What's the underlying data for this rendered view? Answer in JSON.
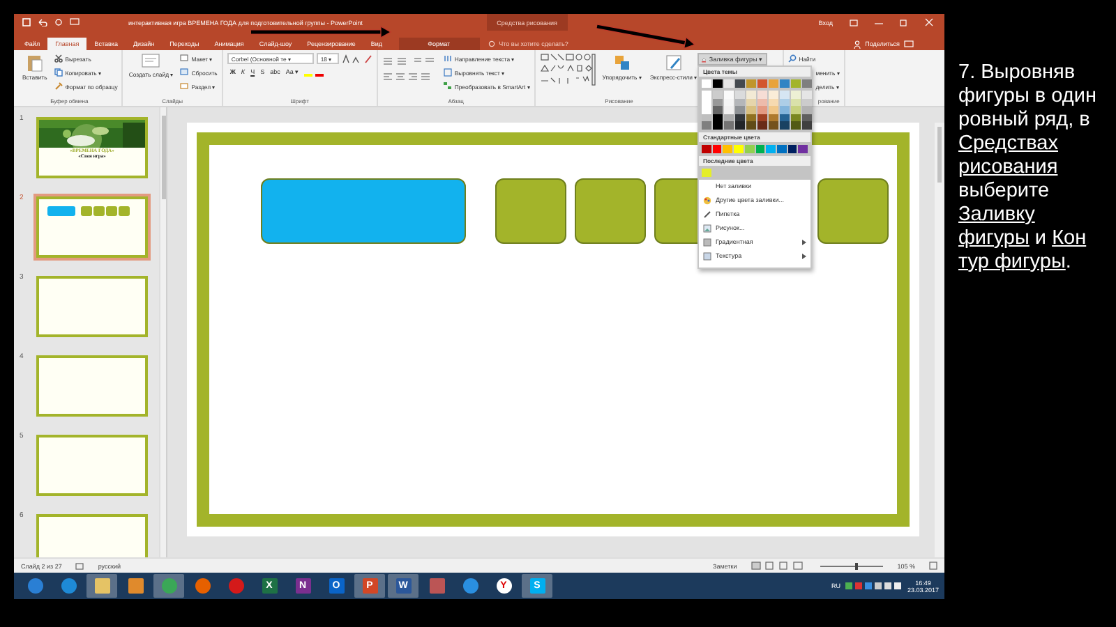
{
  "title_bar": {
    "title": "интерактивная игра ВРЕМЕНА ГОДА  для подготовительной группы  -  PowerPoint",
    "context_title": "Средства рисования",
    "sign_in": "Вход"
  },
  "tabs": [
    {
      "label": "Файл",
      "selected": false,
      "kind": "file"
    },
    {
      "label": "Главная",
      "selected": true,
      "kind": "main"
    },
    {
      "label": "Вставка",
      "selected": false,
      "kind": "main"
    },
    {
      "label": "Дизайн",
      "selected": false,
      "kind": "main"
    },
    {
      "label": "Переходы",
      "selected": false,
      "kind": "main"
    },
    {
      "label": "Анимация",
      "selected": false,
      "kind": "main"
    },
    {
      "label": "Слайд-шоу",
      "selected": false,
      "kind": "main"
    },
    {
      "label": "Рецензирование",
      "selected": false,
      "kind": "main"
    },
    {
      "label": "Вид",
      "selected": false,
      "kind": "main"
    },
    {
      "label": "Формат",
      "selected": false,
      "kind": "context"
    }
  ],
  "tell_me": {
    "placeholder": "Что вы хотите сделать?"
  },
  "share": "Поделиться",
  "ribbon": {
    "groups": [
      {
        "label": "Буфер обмена",
        "kind": "plain",
        "columns": [
          [
            {
              "kind": "large",
              "label": "Вставить"
            }
          ],
          [
            {
              "kind": "small",
              "label": "Вырезать"
            },
            {
              "kind": "small",
              "label": "Копировать  ▾"
            },
            {
              "kind": "small",
              "label": "Формат по образцу"
            }
          ]
        ]
      },
      {
        "label": "Слайды",
        "kind": "plain",
        "columns": [
          [
            {
              "kind": "large",
              "label": "Создать слайд ▾"
            }
          ],
          [
            {
              "kind": "small",
              "label": "Макет ▾"
            },
            {
              "kind": "small",
              "label": "Сбросить"
            },
            {
              "kind": "small",
              "label": "Раздел ▾"
            }
          ]
        ]
      },
      {
        "label": "Шрифт",
        "kind": "plain",
        "columns": [
          [
            {
              "kind": "font",
              "font": "Corbel (Основной те ▾",
              "size": "18 ▾"
            },
            {
              "kind": "glyphs",
              "glyphs": [
                "Ж",
                "К",
                "Ч",
                "S",
                "abc",
                "Aa ▾"
              ]
            }
          ]
        ]
      },
      {
        "label": "Абзац",
        "kind": "plain",
        "columns": [
          [
            {
              "kind": "para"
            }
          ],
          [
            {
              "kind": "small",
              "label": "Направление текста ▾"
            },
            {
              "kind": "small",
              "label": "Выровнять текст ▾"
            },
            {
              "kind": "small",
              "label": "Преобразовать в SmartArt ▾"
            }
          ]
        ]
      },
      {
        "label": "Рисование",
        "kind": "drawing",
        "columns": [
          [
            {
              "kind": "shapes"
            }
          ],
          [
            {
              "kind": "large",
              "label": "Упорядочить ▾"
            }
          ],
          [
            {
              "kind": "large",
              "label": "Экспресс-стили ▾"
            }
          ]
        ]
      },
      {
        "label": "рование",
        "kind": "cut",
        "columns": [
          [
            {
              "kind": "small",
              "label": "Найти"
            },
            {
              "kind": "partial",
              "label": "менить ▾"
            },
            {
              "kind": "partial",
              "label": "делить ▾"
            }
          ]
        ]
      }
    ]
  },
  "fill_menu": {
    "button": "Заливка фигуры ▾",
    "theme_header": "Цвета темы",
    "theme_colors": [
      {
        "color": "#ffffff"
      },
      {
        "color": "#000000"
      },
      {
        "color": "#e7e6e6"
      },
      {
        "color": "#44494f"
      },
      {
        "color": "#c0962c"
      },
      {
        "color": "#d2562e"
      },
      {
        "color": "#e8a33a"
      },
      {
        "color": "#3184c4"
      },
      {
        "color": "#a3b42a"
      },
      {
        "color": "#7f7f7f"
      }
    ],
    "standard_header": "Стандартные цвета",
    "standard_colors": [
      {
        "color": "#c00000"
      },
      {
        "color": "#ff0000"
      },
      {
        "color": "#ffc000"
      },
      {
        "color": "#ffff00"
      },
      {
        "color": "#92d050"
      },
      {
        "color": "#00b050"
      },
      {
        "color": "#00b0f0"
      },
      {
        "color": "#0070c0"
      },
      {
        "color": "#002060"
      },
      {
        "color": "#7030a0"
      }
    ],
    "recent_header": "Последние цвета",
    "recent_colors": [
      {
        "color": "#e4ee2a"
      }
    ],
    "items": [
      {
        "label": "Нет заливки",
        "submenu": false
      },
      {
        "label": "Другие цвета заливки...",
        "submenu": false
      },
      {
        "label": "Пипетка",
        "submenu": false
      },
      {
        "label": "Рисунок...",
        "submenu": false
      },
      {
        "label": "Градиентная",
        "submenu": true
      },
      {
        "label": "Текстура",
        "submenu": true
      }
    ]
  },
  "thumbnails": [
    {
      "number": "1",
      "selected": false,
      "kind": "title",
      "texts": [
        "«ВРЕМЕНА ГОДА»",
        "«Своя игра»"
      ]
    },
    {
      "number": "2",
      "selected": true,
      "kind": "shapes"
    },
    {
      "number": "3",
      "selected": false,
      "kind": "blank"
    },
    {
      "number": "4",
      "selected": false,
      "kind": "blank"
    },
    {
      "number": "5",
      "selected": false,
      "kind": "blank"
    },
    {
      "number": "6",
      "selected": false,
      "kind": "blank"
    }
  ],
  "slide": {
    "shapes": [
      {
        "kind": "wide",
        "color": "#12b2ee"
      },
      {
        "kind": "square",
        "color": "#a3b42a"
      },
      {
        "kind": "square",
        "color": "#a3b42a"
      },
      {
        "kind": "square",
        "color": "#a3b42a"
      },
      {
        "kind": "square",
        "color": "#a3b42a"
      }
    ]
  },
  "status_bar": {
    "slide": "Слайд 2 из 27",
    "language": "русский",
    "notes": "Заметки",
    "zoom": {
      "level": 0.55
    },
    "zoom_text": "105 %"
  },
  "taskbar": {
    "apps": [
      {
        "kind": "start",
        "running": false
      },
      {
        "kind": "ie",
        "running": false
      },
      {
        "kind": "explorer",
        "running": true
      },
      {
        "kind": "media",
        "running": false
      },
      {
        "kind": "chrome",
        "running": true
      },
      {
        "kind": "firefox",
        "running": false
      },
      {
        "kind": "opera",
        "running": false
      },
      {
        "kind": "excel",
        "glyph": "X",
        "running": false
      },
      {
        "kind": "onenote",
        "glyph": "N",
        "running": false
      },
      {
        "kind": "outlook",
        "glyph": "O",
        "running": false
      },
      {
        "kind": "powerpoint",
        "glyph": "P",
        "running": true
      },
      {
        "kind": "word",
        "glyph": "W",
        "running": true
      },
      {
        "kind": "paint",
        "running": false
      },
      {
        "kind": "network",
        "running": false
      },
      {
        "kind": "yandex",
        "glyph": "Y",
        "running": false
      },
      {
        "kind": "skype",
        "glyph": "S",
        "running": true
      }
    ],
    "language": "RU",
    "time": "16:49",
    "date": "23.03.2017"
  },
  "caption": [
    {
      "text": "7.  Выровняв фигуры в один ровный ряд, в ",
      "kind": "text"
    },
    {
      "text": "Средствах",
      "kind": "link"
    },
    {
      "text": "рисования",
      "kind": "link"
    },
    {
      "text": " выберите ",
      "kind": "text"
    },
    {
      "text": "Заливку",
      "kind": "link"
    },
    {
      "text": "фигуры",
      "kind": "link"
    },
    {
      "text": " и ",
      "kind": "text"
    },
    {
      "text": "Кон",
      "kind": "link"
    },
    {
      "text": "тур фигуры",
      "kind": "link"
    },
    {
      "text": ".",
      "kind": "text"
    }
  ]
}
